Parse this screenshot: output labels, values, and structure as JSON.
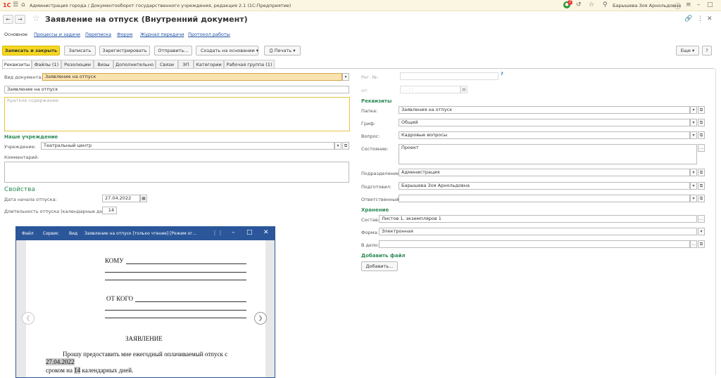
{
  "app": {
    "logo": "1С",
    "window_title": "Администрация города / Документооборот государственного учреждения, редакция 2.1  (1С:Предприятие)",
    "user_name": "Барышева Зоя Арнольдовна",
    "notification_count": "2"
  },
  "doc": {
    "title": "Заявление на отпуск (Внутренний документ)"
  },
  "links": [
    "Основное",
    "Процессы и задачи",
    "Переписка",
    "Форум",
    "Журнал передачи",
    "Протокол работы"
  ],
  "toolbar": {
    "save_close": "Записать и закрыть",
    "save": "Записать",
    "register": "Зарегистрировать",
    "send": "Отправить...",
    "create_based": "Создать на основании",
    "print": "Печать",
    "more": "Еще"
  },
  "tabs": [
    "Реквизиты",
    "Файлы (1)",
    "Резолюции",
    "Визы",
    "Дополнительно",
    "Связи",
    "ЭП",
    "Категории",
    "Рабочая группа (1)"
  ],
  "form": {
    "doc_type_label": "Вид документа:",
    "doc_type_value": "Заявление на отпуск",
    "title_value": "Заявление на отпуск",
    "summary_placeholder": "Краткое содержание",
    "our_org_header": "Наше учреждение",
    "org_label": "Учреждение:",
    "org_value": "Театральный центр",
    "comment_label": "Комментарий:",
    "props_header": "Свойства",
    "start_label": "Дата начала отпуска:",
    "start_value": "27.04.2022",
    "duration_label": "Длительность отпуска (календарные дни):",
    "duration_value": "14"
  },
  "right": {
    "reg_label": "Рег. №:",
    "help": "?",
    "from_label": "от:",
    "date_mask": "  .  .        :  :",
    "requisites_header": "Реквизиты",
    "folder_label": "Папка:",
    "folder_value": "Заявления на отпуск",
    "grif_label": "Гриф:",
    "grif_value": "Общий",
    "question_label": "Вопрос:",
    "question_value": "Кадровые вопросы",
    "state_label": "Состояние:",
    "state_value": "Проект",
    "dept_label": "Подразделение:",
    "dept_value": "Администрация",
    "prepared_label": "Подготовил:",
    "prepared_value": "Барышева Зоя Арнольдовна",
    "responsible_label": "Ответственный:",
    "storage_header": "Хранение",
    "composition_label": "Состав:",
    "composition_value": "Листов 1, экземпляров 1",
    "form_label": "Форма:",
    "form_value": "Электронная",
    "case_label": "В дело:",
    "add_file_header": "Добавить файл",
    "add_button": "Добавить..."
  },
  "popup": {
    "menu": [
      "Файл",
      "Сервис",
      "Вид"
    ],
    "title": "Заявление на отпуск [только чтение] [Режим ог...",
    "to": "КОМУ",
    "from": "ОТ КОГО",
    "heading": "ЗАЯВЛЕНИЕ",
    "body1": "Прошу  предоставить  мне  ежегодный  оплачиваемый  отпуск  с",
    "date": "27.04.2022",
    "body2a": "сроком на ",
    "days": "14",
    "body2b": " календарных дней."
  },
  "colors": {
    "accent_green": "#2e8b57",
    "primary_button": "#f6d820",
    "link_blue": "#1a4fa0",
    "viewer_blue": "#2b579a"
  }
}
